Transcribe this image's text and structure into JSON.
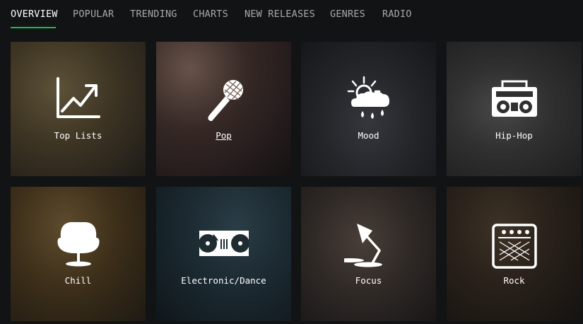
{
  "nav": {
    "items": [
      {
        "label": "OVERVIEW",
        "active": true
      },
      {
        "label": "POPULAR",
        "active": false
      },
      {
        "label": "TRENDING",
        "active": false
      },
      {
        "label": "CHARTS",
        "active": false
      },
      {
        "label": "NEW RELEASES",
        "active": false
      },
      {
        "label": "GENRES",
        "active": false
      },
      {
        "label": "RADIO",
        "active": false
      }
    ],
    "accent_color": "#1db954"
  },
  "tiles": [
    {
      "label": "Top Lists",
      "icon": "trending-chart-icon"
    },
    {
      "label": "Pop",
      "icon": "microphone-icon"
    },
    {
      "label": "Mood",
      "icon": "sun-rain-cloud-icon"
    },
    {
      "label": "Hip-Hop",
      "icon": "boombox-icon"
    },
    {
      "label": "Chill",
      "icon": "egg-chair-icon"
    },
    {
      "label": "Electronic/Dance",
      "icon": "turntables-mixer-icon"
    },
    {
      "label": "Focus",
      "icon": "desk-lamp-icon"
    },
    {
      "label": "Rock",
      "icon": "guitar-amplifier-icon"
    }
  ]
}
